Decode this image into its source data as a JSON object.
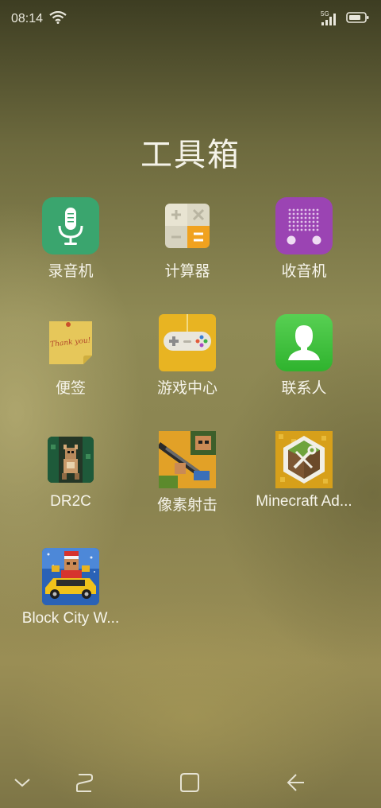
{
  "status": {
    "time": "08:14",
    "network": "5G"
  },
  "folder": {
    "title": "工具箱"
  },
  "apps": [
    {
      "label": "录音机"
    },
    {
      "label": "计算器"
    },
    {
      "label": "收音机"
    },
    {
      "label": "便签"
    },
    {
      "label": "游戏中心"
    },
    {
      "label": "联系人"
    },
    {
      "label": "DR2C"
    },
    {
      "label": "像素射击"
    },
    {
      "label": "Minecraft Ad..."
    },
    {
      "label": "Block City W..."
    }
  ],
  "icons": {
    "recorder": "microphone-icon",
    "calculator": "calculator-icon",
    "radio": "radio-icon",
    "notes": "sticky-note-icon",
    "game_center": "gamepad-icon",
    "contacts": "contact-person-icon",
    "dr2c": "dr2c-game-icon",
    "pixel_shooter": "pixel-shooter-game-icon",
    "minecraft": "minecraft-addons-icon",
    "block_city": "block-city-game-icon"
  },
  "note_text": "Thank you!",
  "colors": {
    "recorder_green": "#3aa56e",
    "radio_purple": "#9b44b3",
    "contacts_green": "#3cbb3a",
    "game_yellow": "#e8b422",
    "calc_orange": "#f0a21f"
  }
}
